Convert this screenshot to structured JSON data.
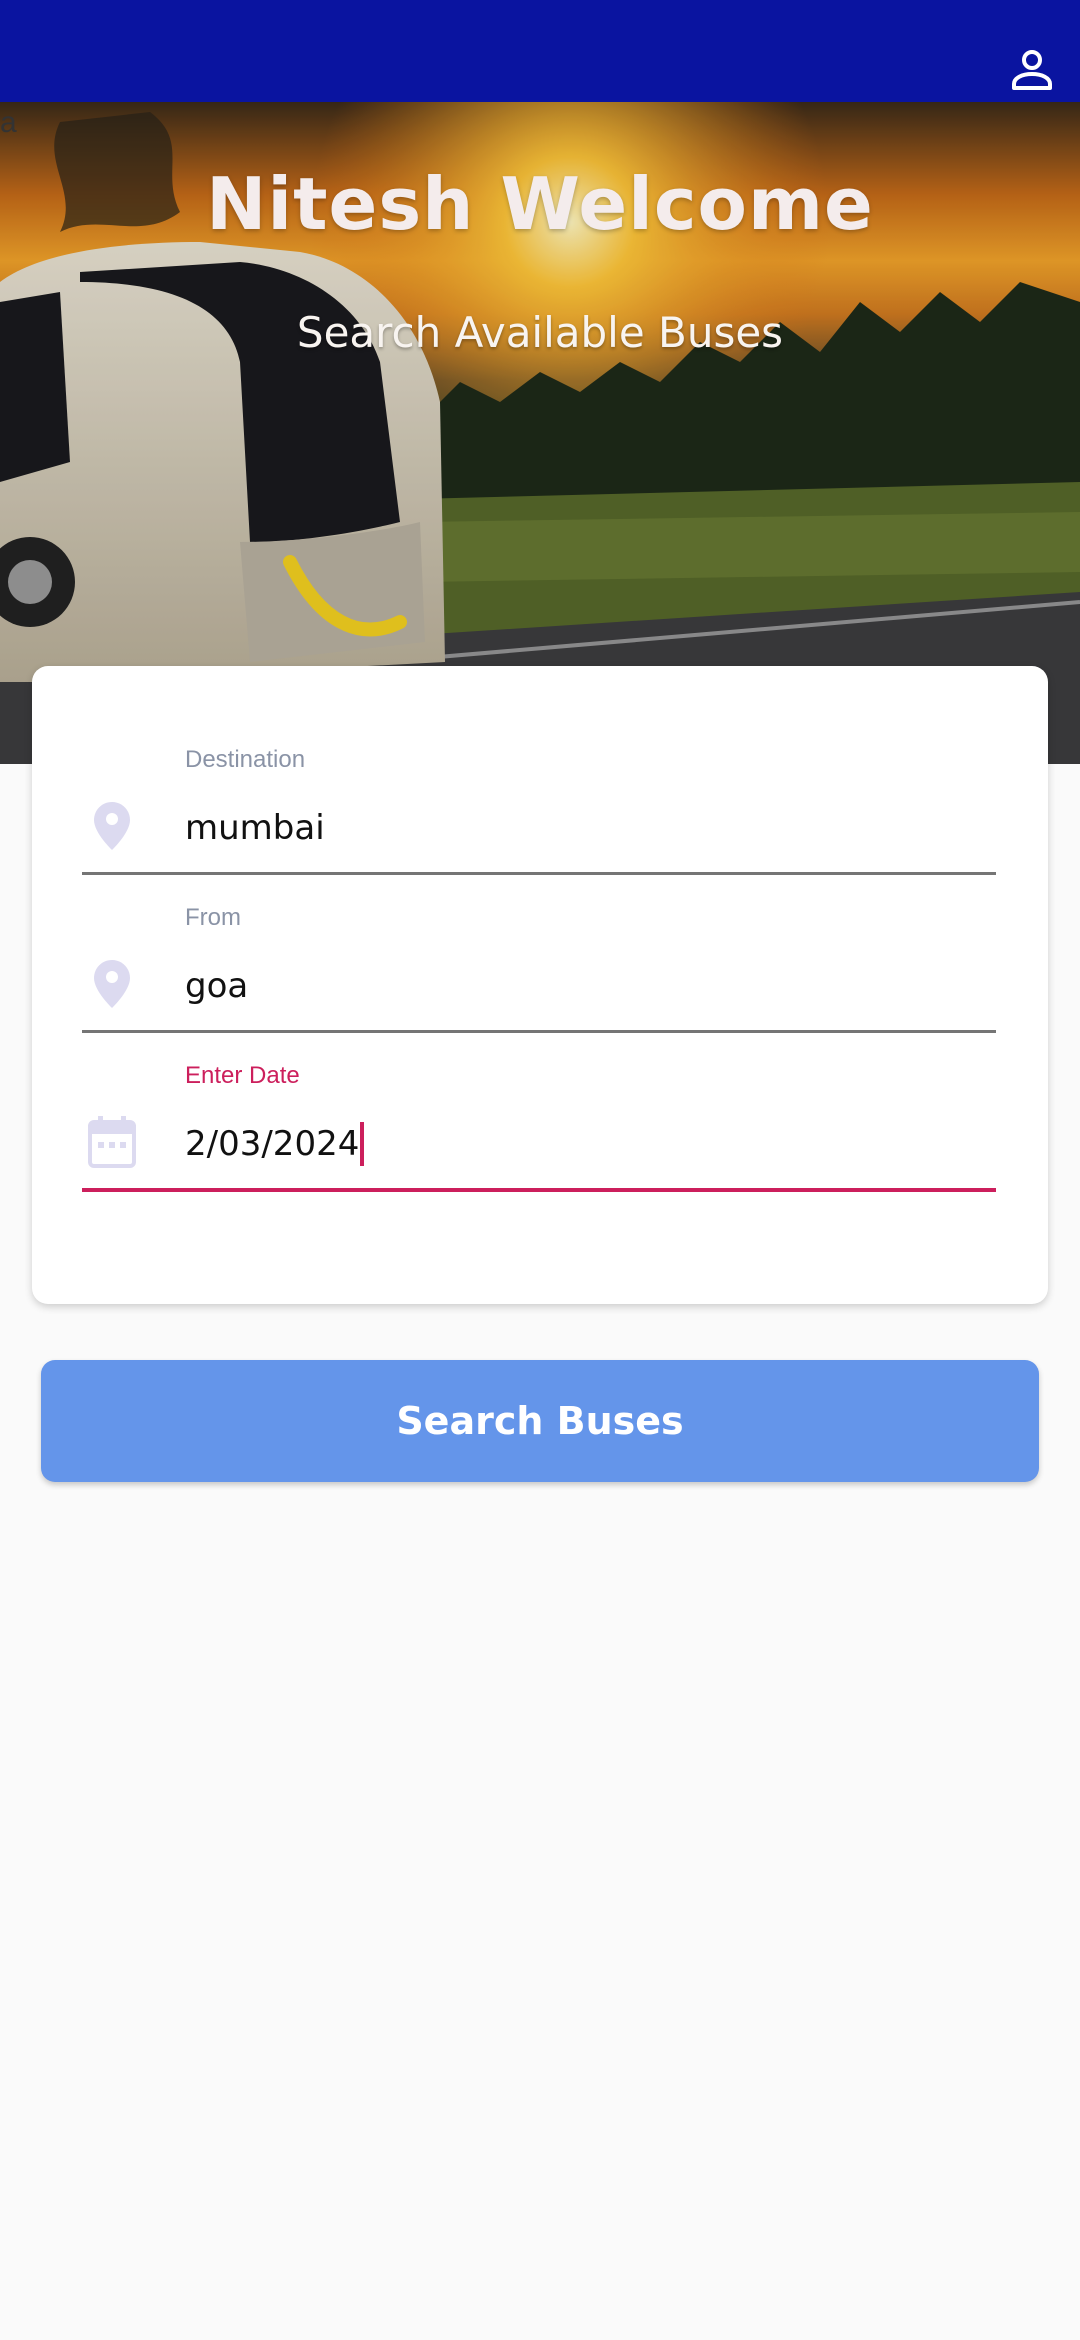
{
  "header": {
    "profile_icon": "person-icon",
    "background_color": "#0a14a0"
  },
  "hero": {
    "stray_text": "a",
    "title": "Nitesh Welcome",
    "subtitle": "Search Available Buses"
  },
  "form": {
    "destination": {
      "label": "Destination",
      "value": "mumbai",
      "icon": "location-pin-icon"
    },
    "from": {
      "label": "From",
      "value": "goa",
      "icon": "location-pin-icon"
    },
    "date": {
      "label": "Enter Date",
      "value": "2/03/2024",
      "icon": "calendar-icon",
      "focused": true
    }
  },
  "search_button": {
    "label": "Search Buses",
    "color": "#6495ea"
  },
  "colors": {
    "accent": "#cc1f5c",
    "label": "#8a93a6",
    "icon": "#dcdaf0"
  }
}
